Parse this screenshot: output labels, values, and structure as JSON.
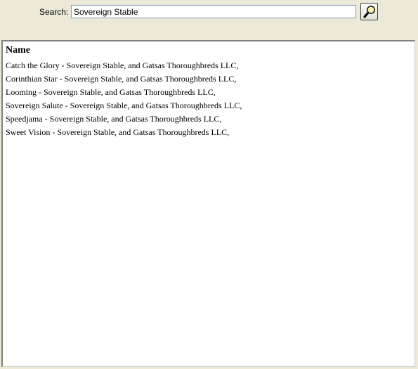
{
  "search": {
    "label": "Search:",
    "value": "Sovereign Stable",
    "button_icon": "magnifier-icon"
  },
  "results": {
    "header": "Name",
    "items": [
      "Catch the Glory - Sovereign Stable, and Gatsas Thoroughbreds LLC,",
      "Corinthian Star - Sovereign Stable, and Gatsas Thoroughbreds LLC,",
      "Looming - Sovereign Stable, and Gatsas Thoroughbreds LLC,",
      "Sovereign Salute - Sovereign Stable, and Gatsas Thoroughbreds LLC,",
      "Speedjama - Sovereign Stable, and Gatsas Thoroughbreds LLC,",
      "Sweet Vision - Sovereign Stable, and Gatsas Thoroughbreds LLC,"
    ]
  },
  "colors": {
    "window_background": "#ece9d8",
    "input_border": "#7f9db9",
    "panel_background": "#ffffff"
  }
}
